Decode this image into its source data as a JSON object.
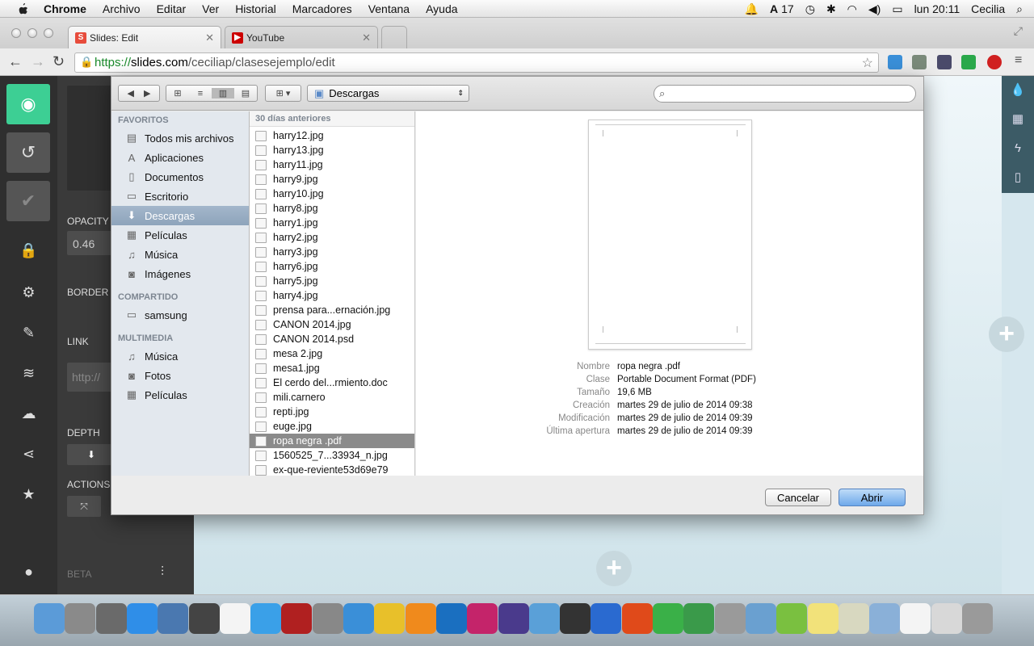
{
  "menubar": {
    "app_name": "Chrome",
    "items": [
      "Archivo",
      "Editar",
      "Ver",
      "Historial",
      "Marcadores",
      "Ventana",
      "Ayuda"
    ],
    "battery_label": "17",
    "clock": "lun 20:11",
    "user": "Cecilia"
  },
  "browser": {
    "tabs": [
      {
        "label": "Slides: Edit",
        "favicon": "S",
        "color": "#e74c3c"
      },
      {
        "label": "YouTube",
        "favicon": "▶",
        "color": "#cc0000"
      }
    ],
    "url": {
      "scheme": "https://",
      "host": "slides.com",
      "path": "/ceciliap/clasesejemplo/edit"
    }
  },
  "editor": {
    "panel": {
      "opacity_label": "OPACITY",
      "opacity_value": "0.46",
      "border_label": "BORDER",
      "link_label": "LINK",
      "link_placeholder": "http://",
      "depth_label": "DEPTH",
      "actions_label": "ACTIONS",
      "beta_label": "BETA"
    },
    "accent_color": "#3dcf94"
  },
  "dialog": {
    "location": "Descargas",
    "sidebar": {
      "sections": [
        {
          "title": "FAVORITOS",
          "items": [
            {
              "label": "Todos mis archivos",
              "icon": "all-files-icon"
            },
            {
              "label": "Aplicaciones",
              "icon": "applications-icon"
            },
            {
              "label": "Documentos",
              "icon": "documents-icon"
            },
            {
              "label": "Escritorio",
              "icon": "desktop-icon"
            },
            {
              "label": "Descargas",
              "icon": "downloads-icon",
              "selected": true
            },
            {
              "label": "Películas",
              "icon": "movies-icon"
            },
            {
              "label": "Música",
              "icon": "music-icon"
            },
            {
              "label": "Imágenes",
              "icon": "pictures-icon"
            }
          ]
        },
        {
          "title": "COMPARTIDO",
          "items": [
            {
              "label": "samsung",
              "icon": "computer-icon"
            }
          ]
        },
        {
          "title": "MULTIMEDIA",
          "items": [
            {
              "label": "Música",
              "icon": "music-icon"
            },
            {
              "label": "Fotos",
              "icon": "camera-icon"
            },
            {
              "label": "Películas",
              "icon": "movies-icon"
            }
          ]
        }
      ]
    },
    "file_group_header": "30 días anteriores",
    "files": [
      "harry12.jpg",
      "harry13.jpg",
      "harry11.jpg",
      "harry9.jpg",
      "harry10.jpg",
      "harry8.jpg",
      "harry1.jpg",
      "harry2.jpg",
      "harry3.jpg",
      "harry6.jpg",
      "harry5.jpg",
      "harry4.jpg",
      "prensa para...ernación.jpg",
      "CANON 2014.jpg",
      "CANON 2014.psd",
      "mesa 2.jpg",
      "mesa1.jpg",
      "El cerdo del...rmiento.doc",
      "mili.carnero",
      "repti.jpg",
      "euge.jpg",
      "ropa negra .pdf",
      "1560525_7...33934_n.jpg",
      "ex-que-reviente53d69e79"
    ],
    "selected_file": "ropa negra .pdf",
    "info": [
      {
        "key": "Nombre",
        "value": "ropa negra .pdf"
      },
      {
        "key": "Clase",
        "value": "Portable Document Format (PDF)"
      },
      {
        "key": "Tamaño",
        "value": "19,6 MB"
      },
      {
        "key": "Creación",
        "value": "martes 29 de julio de 2014 09:38"
      },
      {
        "key": "Modificación",
        "value": "martes 29 de julio de 2014 09:39"
      },
      {
        "key": "Última apertura",
        "value": "martes 29 de julio de 2014 09:39"
      }
    ],
    "cancel_label": "Cancelar",
    "open_label": "Abrir"
  },
  "dock": {
    "apps": [
      {
        "name": "finder-icon",
        "color": "#5b9bd8"
      },
      {
        "name": "launchpad-icon",
        "color": "#8a8a8a"
      },
      {
        "name": "dashboard-icon",
        "color": "#6a6a6a"
      },
      {
        "name": "app-store-icon",
        "color": "#2f8ee8"
      },
      {
        "name": "preview-icon",
        "color": "#4a78b0"
      },
      {
        "name": "facetime-icon",
        "color": "#444444"
      },
      {
        "name": "calendar-icon",
        "color": "#f4f4f4"
      },
      {
        "name": "itunes-icon",
        "color": "#3aa0e8"
      },
      {
        "name": "photo-booth-icon",
        "color": "#b02020"
      },
      {
        "name": "system-preferences-icon",
        "color": "#888888"
      },
      {
        "name": "safari-icon",
        "color": "#3a8fd8"
      },
      {
        "name": "chrome-icon",
        "color": "#e8c02a"
      },
      {
        "name": "illustrator-icon",
        "color": "#f08a1c"
      },
      {
        "name": "photoshop-icon",
        "color": "#1a6fc0"
      },
      {
        "name": "indesign-icon",
        "color": "#c4246a"
      },
      {
        "name": "premiere-icon",
        "color": "#4a3a8c"
      },
      {
        "name": "utility-icon",
        "color": "#5aa0d8"
      },
      {
        "name": "imovie-icon",
        "color": "#333333"
      },
      {
        "name": "word-icon",
        "color": "#2a6ad0"
      },
      {
        "name": "powerpoint-icon",
        "color": "#e04a1a"
      },
      {
        "name": "messenger-icon",
        "color": "#3ab048"
      },
      {
        "name": "network-icon",
        "color": "#3a9a4a"
      },
      {
        "name": "screen-share-icon",
        "color": "#9a9a9a"
      },
      {
        "name": "boot-camp-icon",
        "color": "#6aa0d0"
      },
      {
        "name": "evernote-icon",
        "color": "#7ac040"
      },
      {
        "name": "stickies-icon",
        "color": "#f2e27a"
      },
      {
        "name": "handwriting-icon",
        "color": "#d8d8c0"
      },
      {
        "name": "applications-folder-icon",
        "color": "#8ab0d8"
      },
      {
        "name": "document-icon",
        "color": "#f4f4f4"
      },
      {
        "name": "downloads-stack-icon",
        "color": "#d8d8d8"
      },
      {
        "name": "trash-icon",
        "color": "#9a9a9a"
      }
    ]
  }
}
